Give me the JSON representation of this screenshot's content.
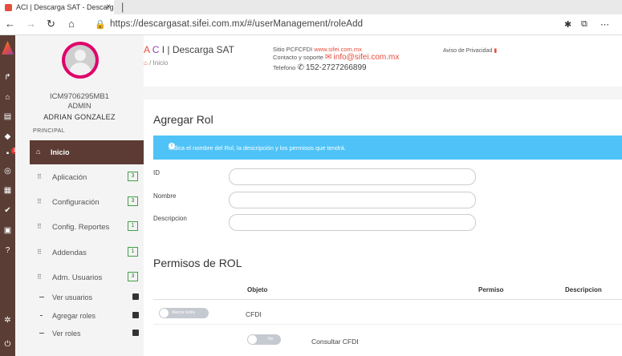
{
  "browser": {
    "tab_title": "ACI | Descarga SAT - Descarga gratis",
    "tab_close": "×",
    "new_tab": "|",
    "url": "https://descargasat.sifei.com.mx/#/userManagement/roleAdd",
    "back": "←",
    "forward": "→",
    "reload": "↻",
    "home": "⌂",
    "lock": "🔒"
  },
  "user": {
    "name": "ADRIAN GONZALEZ",
    "rfc": "ICM9706295MB1",
    "role": "ADMIN"
  },
  "sidebar": {
    "section": "PRINCIPAL",
    "active": {
      "label": "Inicio",
      "icon": "home-icon"
    },
    "items": [
      {
        "label": "Aplicación",
        "badge": "3"
      },
      {
        "label": "Configuración",
        "badge": "3"
      },
      {
        "label": "Config. Reportes",
        "badge": "1"
      },
      {
        "label": "Addendas",
        "badge": "1"
      },
      {
        "label": "Adm. Usuarios",
        "badge": "3"
      }
    ],
    "subitems": [
      {
        "label": "Ver usuarios"
      },
      {
        "label": "Agregar roles"
      },
      {
        "label": "Ver roles"
      }
    ]
  },
  "header": {
    "brand_a": "A",
    "brand_c": "C",
    "brand_rest": "I | Descarga SAT",
    "crumb_sep": "/",
    "crumb": "Inicio",
    "site_label": "Sitio PCFCFDI",
    "site_link": "www.sifei.com.mx",
    "contact_label": "Contacto y soporte",
    "contact_email": "info@sifei.com.mx",
    "phone_label": "Telefono",
    "phone": "152-2727266899",
    "privacy": "Aviso de Privacidad"
  },
  "content": {
    "title": "Agregar Rol",
    "info": "Indica el nombre del Rol, la descripción y los permisos que tendrá.",
    "fields": [
      {
        "label": "ID",
        "value": ""
      },
      {
        "label": "Nombre",
        "value": ""
      },
      {
        "label": "Descripcion",
        "value": ""
      }
    ],
    "permissions_title": "Permisos de ROL",
    "columns": [
      "Objeto",
      "Permiso",
      "Descripcion"
    ],
    "rows": [
      {
        "toggle": "Marcar todos",
        "object": "CFDI"
      },
      {
        "toggle": "No",
        "object": "Consultar CFDI"
      }
    ]
  },
  "colors": {
    "accent": "#e74c3c",
    "sidebar_active": "#5b3b33",
    "info_banner": "#4fc3f7",
    "badge": "#43a047"
  }
}
